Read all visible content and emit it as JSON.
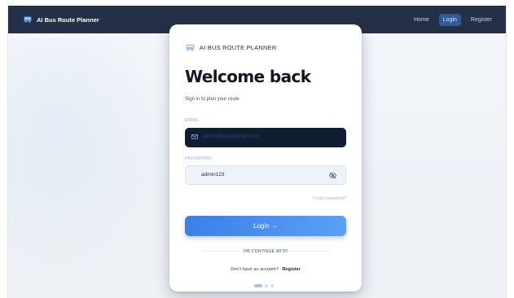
{
  "navbar": {
    "brand": "AI Bus Route Planner",
    "links": [
      "Home",
      "Login",
      "Register"
    ],
    "active_link": "Login"
  },
  "card": {
    "brand": "AI BUS ROUTE PLANNER",
    "title": "Welcome back",
    "subtitle": "Sign in to plan your route",
    "email": {
      "label": "EMAIL",
      "value": "admin@busplanner.com"
    },
    "password": {
      "label": "PASSWORD",
      "value": "admin123"
    },
    "forgot_password": "Forgot password?",
    "login_button": "Login →",
    "divider": "OR CONTINUE WITH",
    "register_prompt": "Don't have an account?",
    "register_link": "Register"
  },
  "colors": {
    "navbar_bg": "#243047",
    "accent": "#3c7fe8",
    "email_field_bg": "#0f1e33",
    "brand_icon": "#5b9ae8"
  },
  "icons": {
    "brand": "bus-icon",
    "email": "mail-icon",
    "password_toggle": "eye-off-icon"
  }
}
